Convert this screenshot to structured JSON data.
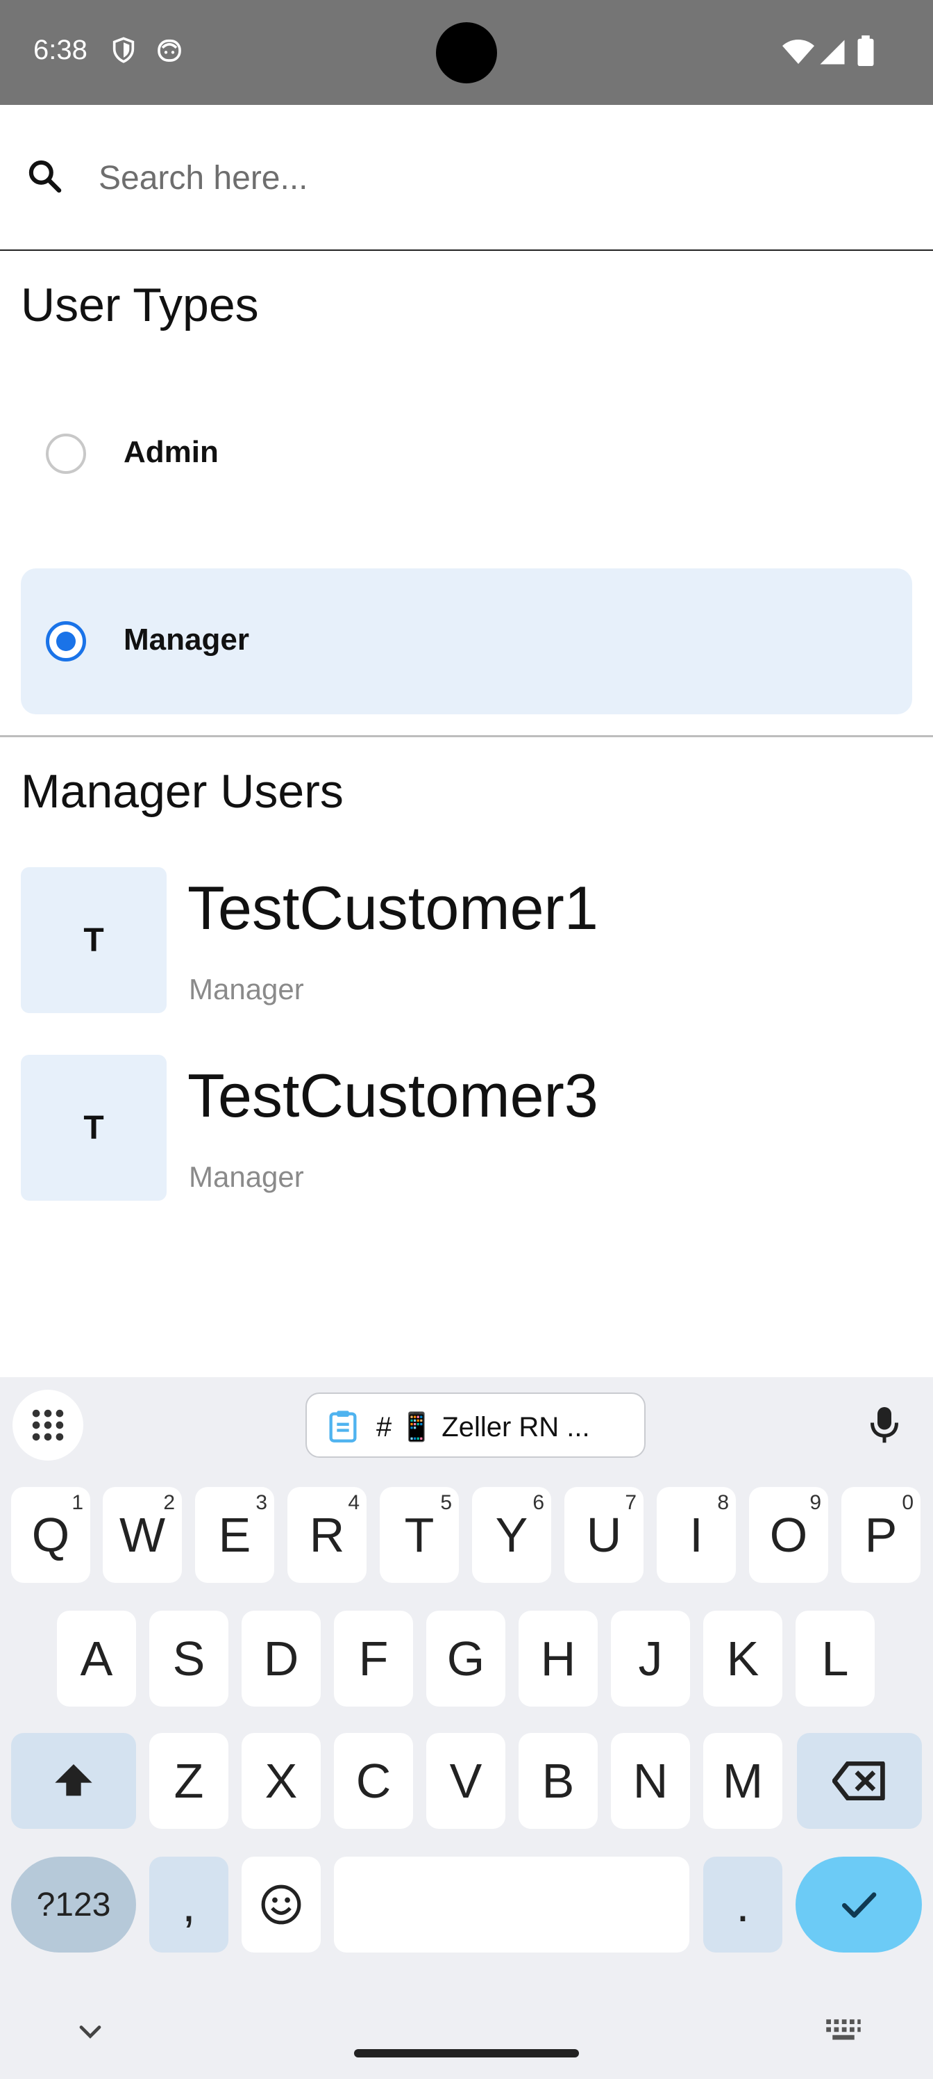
{
  "status_bar": {
    "time": "6:38",
    "left_icons": [
      "shield-icon",
      "face-icon"
    ],
    "right_icons": [
      "wifi-icon",
      "signal-icon",
      "battery-icon"
    ]
  },
  "search": {
    "placeholder": "Search here...",
    "value": ""
  },
  "user_types": {
    "title": "User Types",
    "options": [
      {
        "label": "Admin",
        "selected": false
      },
      {
        "label": "Manager",
        "selected": true
      }
    ]
  },
  "users_section": {
    "title": "Manager Users",
    "users": [
      {
        "initial": "T",
        "name": "TestCustomer1",
        "role": "Manager"
      },
      {
        "initial": "T",
        "name": "TestCustomer3",
        "role": "Manager"
      }
    ]
  },
  "keyboard": {
    "clipboard_chip": "# 📱 Zeller RN ...",
    "row1": [
      {
        "key": "Q",
        "hint": "1"
      },
      {
        "key": "W",
        "hint": "2"
      },
      {
        "key": "E",
        "hint": "3"
      },
      {
        "key": "R",
        "hint": "4"
      },
      {
        "key": "T",
        "hint": "5"
      },
      {
        "key": "Y",
        "hint": "6"
      },
      {
        "key": "U",
        "hint": "7"
      },
      {
        "key": "I",
        "hint": "8"
      },
      {
        "key": "O",
        "hint": "9"
      },
      {
        "key": "P",
        "hint": "0"
      }
    ],
    "row2": [
      "A",
      "S",
      "D",
      "F",
      "G",
      "H",
      "J",
      "K",
      "L"
    ],
    "row3": [
      "Z",
      "X",
      "C",
      "V",
      "B",
      "N",
      "M"
    ],
    "symbols_key": "?123",
    "comma_key": ",",
    "period_key": ".",
    "accent_color": "#1a73e8"
  }
}
